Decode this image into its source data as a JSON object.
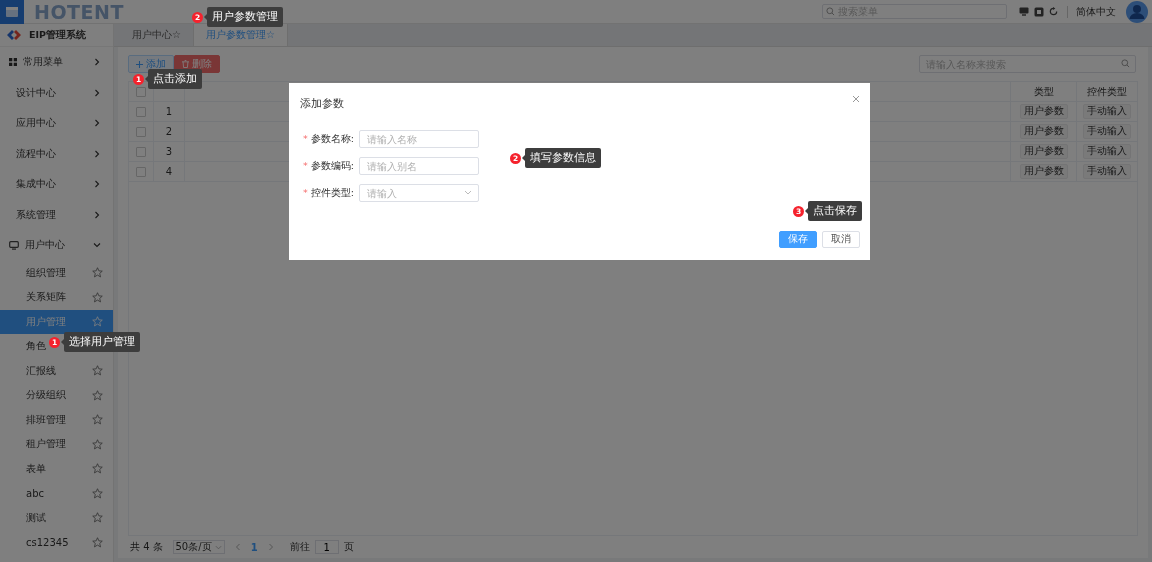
{
  "header": {
    "logo": "HOTENT",
    "search_placeholder": "搜索菜单",
    "language": "简体中文"
  },
  "sidebar": {
    "system": "EIP管理系统",
    "items": [
      {
        "label": "常用菜单",
        "kind": "favorites",
        "expanded": false
      },
      {
        "label": "设计中心",
        "kind": "group",
        "expanded": false
      },
      {
        "label": "应用中心",
        "kind": "group",
        "expanded": false
      },
      {
        "label": "流程中心",
        "kind": "group",
        "expanded": false
      },
      {
        "label": "集成中心",
        "kind": "group",
        "expanded": false
      },
      {
        "label": "系统管理",
        "kind": "group",
        "expanded": false
      },
      {
        "label": "用户中心",
        "kind": "user",
        "expanded": true,
        "children": [
          {
            "label": "组织管理",
            "selected": false
          },
          {
            "label": "关系矩阵",
            "selected": false
          },
          {
            "label": "用户管理",
            "selected": true
          },
          {
            "label": "角色",
            "selected": false
          },
          {
            "label": "汇报线",
            "selected": false
          },
          {
            "label": "分级组织",
            "selected": false
          },
          {
            "label": "排班管理",
            "selected": false
          },
          {
            "label": "租户管理",
            "selected": false
          },
          {
            "label": "表单",
            "selected": false
          },
          {
            "label": "abc",
            "selected": false
          },
          {
            "label": "测试",
            "selected": false
          },
          {
            "label": "cs12345",
            "selected": false
          }
        ]
      }
    ]
  },
  "tabs": [
    {
      "label": "用户中心☆",
      "selected": false
    },
    {
      "label": "用户参数管理☆",
      "selected": true
    }
  ],
  "toolbar": {
    "buttons": [
      {
        "label": "添加",
        "kind": "add"
      },
      {
        "label": "删除",
        "kind": "delete"
      }
    ],
    "search_placeholder": "请输入名称来搜索"
  },
  "table": {
    "all_checked": false,
    "columns": [
      "类型",
      "控件类型"
    ],
    "rows": [
      {
        "checked": false,
        "index": "1",
        "type": "用户参数",
        "control": "手动输入"
      },
      {
        "checked": false,
        "index": "2",
        "type": "用户参数",
        "control": "手动输入"
      },
      {
        "checked": false,
        "index": "3",
        "type": "用户参数",
        "control": "手动输入"
      },
      {
        "checked": false,
        "index": "4",
        "type": "用户参数",
        "control": "手动输入"
      }
    ]
  },
  "pagination": {
    "total": "共 4 条",
    "page_size": "50条/页",
    "pages": [
      {
        "label": "1",
        "selected": true
      }
    ],
    "goto_label": "前往",
    "goto_value": "1",
    "page_unit": "页"
  },
  "dialog": {
    "title": "添加参数",
    "fields": [
      {
        "label": "参数名称:",
        "mark": "*",
        "placeholder": "请输入名称",
        "kind": "input"
      },
      {
        "label": "参数编码:",
        "mark": "*",
        "placeholder": "请输入别名",
        "kind": "input"
      },
      {
        "label": "控件类型:",
        "mark": "*",
        "placeholder": "请输入",
        "kind": "select"
      }
    ],
    "buttons": [
      {
        "label": "保存",
        "kind": "primary"
      },
      {
        "label": "取消",
        "kind": "default"
      }
    ]
  },
  "callouts": [
    {
      "number": "2",
      "text": "用户参数管理"
    },
    {
      "number": "1",
      "text": "点击添加"
    },
    {
      "number": "2",
      "text": "填写参数信息"
    },
    {
      "number": "3",
      "text": "点击保存"
    },
    {
      "number": "1",
      "text": "选择用户管理"
    }
  ]
}
